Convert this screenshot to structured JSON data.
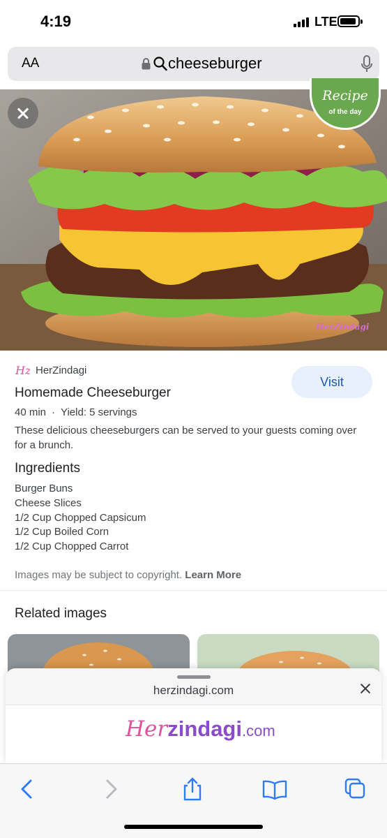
{
  "status_bar": {
    "time": "4:19",
    "network": "LTE"
  },
  "address_bar": {
    "text_size_label": "AA",
    "url_text": "cheeseburger"
  },
  "hero": {
    "badge_title": "Recipe",
    "badge_subtitle": "of the day",
    "watermark": "HerZindagi"
  },
  "result": {
    "source_logo_text": "Hz",
    "source": "HerZindagi",
    "title": "Homemade Cheeseburger",
    "time": "40 min",
    "separator": "·",
    "yield": "Yield: 5 servings",
    "description": "These delicious cheeseburgers can be served to your guests coming over for a brunch.",
    "visit_label": "Visit",
    "ingredients_heading": "Ingredients",
    "ingredients": [
      "Burger Buns",
      "Cheese Slices",
      "1/2 Cup Chopped Capsicum",
      "1/2 Cup Boiled Corn",
      "1/2 Cup Chopped Carrot"
    ],
    "copyright_text": "Images may be subject to copyright.",
    "learn_more": "Learn More"
  },
  "related": {
    "heading": "Related images"
  },
  "sheet": {
    "domain": "herzindagi.com",
    "logo_her": "Her",
    "logo_zindagi": "zindagi",
    "logo_com": ".com"
  },
  "colors": {
    "accent_blue": "#1a56b8",
    "visit_bg": "#e8f0fe",
    "badge_green": "#6aa84f",
    "brand_pink": "#e0529c",
    "brand_purple": "#8a4cc8",
    "ios_blue": "#2f7bf6"
  },
  "toolbar": {
    "icons": [
      "back-icon",
      "forward-icon",
      "share-icon",
      "bookmarks-icon",
      "tabs-icon"
    ]
  }
}
